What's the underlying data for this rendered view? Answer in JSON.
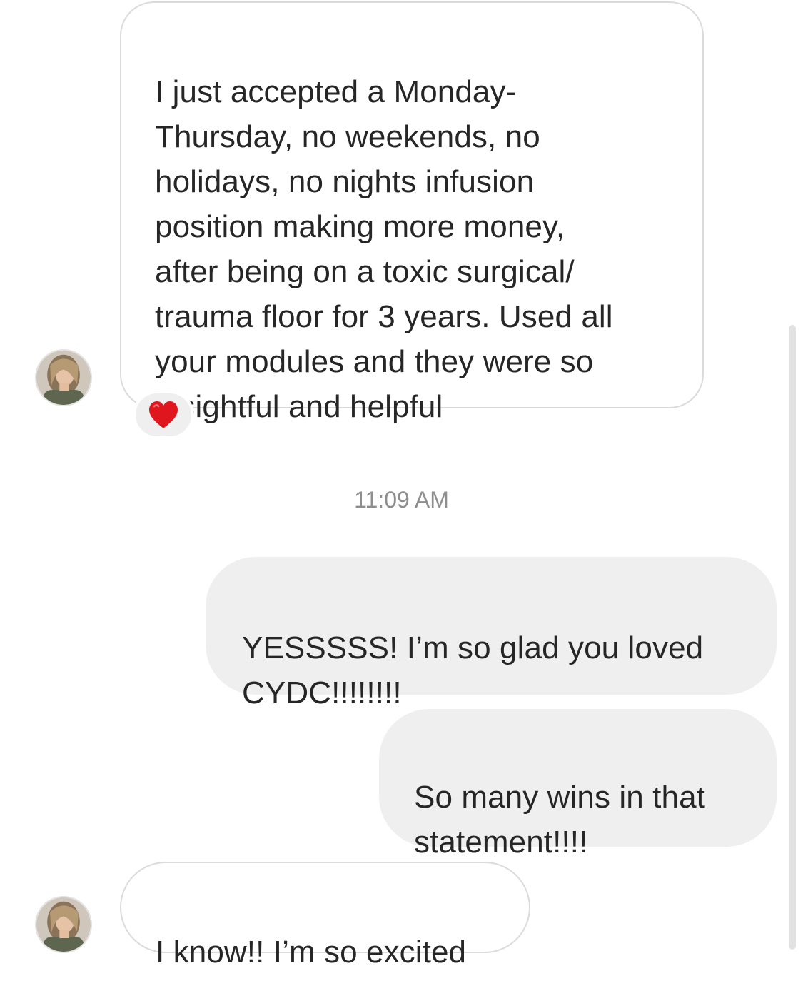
{
  "thread": {
    "messages": [
      {
        "sender": "them",
        "text": "I just accepted a Monday-\nThursday, no weekends, no\nholidays, no nights infusion\nposition making more money,\nafter being on a toxic surgical/\ntrauma floor for 3 years. Used all\nyour modules and they were so\ninsightful and helpful",
        "reaction": "heart"
      },
      {
        "timestamp": "11:09 AM"
      },
      {
        "sender": "me",
        "text": "YESSSSS! I’m so glad you loved\nCYDC!!!!!!!!"
      },
      {
        "sender": "me",
        "text": "So many wins in that\nstatement!!!!"
      },
      {
        "sender": "them",
        "text": "I know!! I’m so excited"
      }
    ]
  },
  "icons": {
    "reaction": "heart-reaction-icon",
    "avatar": "user-avatar-photo"
  },
  "colors": {
    "incoming_bubble_border": "#dbdbdb",
    "outgoing_bubble_bg": "#efefef",
    "text": "#262626",
    "timestamp": "#8e8e8e",
    "heart": "#e0161e"
  }
}
